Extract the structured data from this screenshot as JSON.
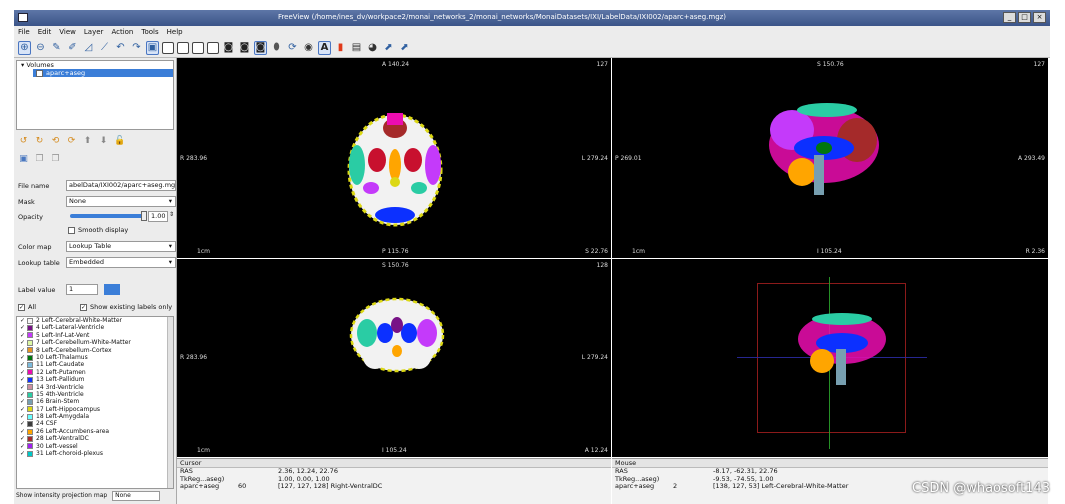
{
  "window": {
    "title": "FreeView (/home/ines_dv/workpace2/monai_networks_2/monai_networks/MonaiDatasets/IXI/LabelData/IXI002/aparc+aseg.mgz)"
  },
  "menu": [
    "File",
    "Edit",
    "View",
    "Layer",
    "Action",
    "Tools",
    "Help"
  ],
  "toolbar_icons": [
    "navigate-icon",
    "roi-edit-icon",
    "voxel-edit-icon",
    "recon-edit-icon",
    "contour-icon",
    "measure-icon",
    "undo-icon",
    "redo-icon",
    "layout-1x1-icon",
    "layout-2x2-icon",
    "layout-1x3-icon",
    "layout-1x3h-icon",
    "layout-single-icon",
    "view-sagittal-icon",
    "view-coronal-icon",
    "view-axial-icon",
    "view-3d-icon",
    "reset-view-icon",
    "toggle-icon",
    "annotation-icon",
    "colorbar-icon",
    "snapshot-icon",
    "record-icon",
    "sync-icon",
    "cursor-sync-icon"
  ],
  "layers": {
    "group": "Volumes",
    "selected": "aparc+aseg"
  },
  "panel": {
    "file_name_label": "File name",
    "file_name": "abelData/IXI002/aparc+aseg.mgz",
    "mask_label": "Mask",
    "mask": "None",
    "opacity_label": "Opacity",
    "opacity": "1.00",
    "opacity_fraction": 1.0,
    "smooth_display": "Smooth display",
    "color_map_label": "Color map",
    "color_map": "Lookup Table",
    "lookup_table_label": "Lookup table",
    "lookup_table": "Embedded",
    "label_value_label": "Label value",
    "label_value": "1",
    "all_label": "All",
    "show_existing": "Show existing labels only",
    "bottom_label": "Show intensity projection map",
    "bottom_value": "None"
  },
  "labels": [
    {
      "text": "2 Left-Cerebral-White-Matter",
      "color": "#f5f5f5"
    },
    {
      "text": "4 Left-Lateral-Ventricle",
      "color": "#781286"
    },
    {
      "text": "5 Left-Inf-Lat-Vent",
      "color": "#c43afa"
    },
    {
      "text": "7 Left-Cerebellum-White-Matter",
      "color": "#dcf8a4"
    },
    {
      "text": "8 Left-Cerebellum-Cortex",
      "color": "#e69422"
    },
    {
      "text": "10 Left-Thalamus",
      "color": "#00760e"
    },
    {
      "text": "11 Left-Caudate",
      "color": "#7abadc"
    },
    {
      "text": "12 Left-Putamen",
      "color": "#ec0db0"
    },
    {
      "text": "13 Left-Pallidum",
      "color": "#0c30ff"
    },
    {
      "text": "14 3rd-Ventricle",
      "color": "#cc8ea0"
    },
    {
      "text": "15 4th-Ventricle",
      "color": "#2acca4"
    },
    {
      "text": "16 Brain-Stem",
      "color": "#779fb0"
    },
    {
      "text": "17 Left-Hippocampus",
      "color": "#dcd814"
    },
    {
      "text": "18 Left-Amygdala",
      "color": "#67ffff"
    },
    {
      "text": "24 CSF",
      "color": "#3c3c3c"
    },
    {
      "text": "26 Left-Accumbens-area",
      "color": "#ffa500"
    },
    {
      "text": "28 Left-VentralDC",
      "color": "#a52a2a"
    },
    {
      "text": "30 Left-vessel",
      "color": "#a020f0"
    },
    {
      "text": "31 Left-choroid-plexus",
      "color": "#00c8c8"
    }
  ],
  "views": {
    "axial": {
      "top": "A 140.24",
      "left": "R 283.96",
      "right": "L 279.24",
      "bottom": "P 115.76",
      "slice": "127",
      "br": "S 22.76",
      "scale": "1cm"
    },
    "sagittal": {
      "top": "S 150.76",
      "left": "P 269.01",
      "right": "A 293.49",
      "bottom": "I 105.24",
      "slice": "127",
      "br": "R 2.36",
      "scale": "1cm"
    },
    "coronal": {
      "top": "S 150.76",
      "left": "R 283.96",
      "right": "L 279.24",
      "bottom": "I 105.24",
      "slice": "128",
      "br": "A 12.24",
      "scale": "1cm"
    }
  },
  "cursor": {
    "title": "Cursor",
    "rows": [
      {
        "c1": "RAS",
        "c2": "",
        "c3": "2.36, 12.24, 22.76"
      },
      {
        "c1": "TkReg...aseg)",
        "c2": "",
        "c3": "1.00, 0.00, 1.00"
      },
      {
        "c1": "aparc+aseg",
        "c2": "60",
        "c3": "[127, 127, 128]  Right-VentralDC"
      }
    ]
  },
  "mouse": {
    "title": "Mouse",
    "rows": [
      {
        "c1": "RAS",
        "c2": "",
        "c3": "-8.17, -62.31, 22.76"
      },
      {
        "c1": "TkReg...aseg)",
        "c2": "",
        "c3": "-9.53, -74.55, 1.00"
      },
      {
        "c1": "aparc+aseg",
        "c2": "2",
        "c3": "[138, 127, 53]  Left-Cerebral-White-Matter"
      }
    ]
  },
  "watermark": "CSDN @whaosoft143"
}
